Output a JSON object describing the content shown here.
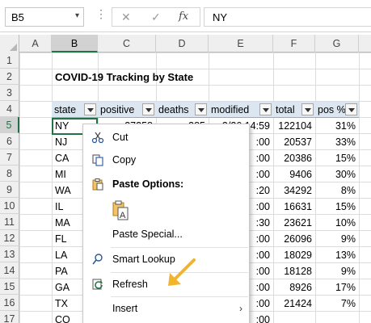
{
  "formula_bar": {
    "name_box": "B5",
    "name_box_arrow": "▾",
    "dots": "⋮",
    "cancel_icon": "✕",
    "enter_icon": "✓",
    "fx_label": "fx",
    "formula": "NY"
  },
  "columns": [
    "A",
    "B",
    "C",
    "D",
    "E",
    "F",
    "G"
  ],
  "rows": [
    "1",
    "2",
    "3",
    "4",
    "5",
    "6",
    "7",
    "8",
    "9",
    "10",
    "11",
    "12",
    "13",
    "14",
    "15",
    "16",
    "17"
  ],
  "title": "COVID-19 Tracking by State",
  "table": {
    "headers": [
      "state",
      "positive",
      "deaths",
      "modified",
      "total",
      "pos %"
    ],
    "rows": [
      {
        "state": "NY",
        "positive": "37258",
        "deaths": "385",
        "modified": "3/26 14:59",
        "total": "122104",
        "pos": "31%"
      },
      {
        "state": "NJ",
        "modified_tail": ":00",
        "total": "20537",
        "pos": "33%"
      },
      {
        "state": "CA",
        "modified_tail": ":00",
        "total": "20386",
        "pos": "15%"
      },
      {
        "state": "MI",
        "modified_tail": ":00",
        "total": "9406",
        "pos": "30%"
      },
      {
        "state": "WA",
        "modified_tail": ":20",
        "total": "34292",
        "pos": "8%"
      },
      {
        "state": "IL",
        "modified_tail": ":00",
        "total": "16631",
        "pos": "15%"
      },
      {
        "state": "MA",
        "modified_tail": ":30",
        "total": "23621",
        "pos": "10%"
      },
      {
        "state": "FL",
        "modified_tail": ":00",
        "total": "26096",
        "pos": "9%"
      },
      {
        "state": "LA",
        "modified_tail": ":00",
        "total": "18029",
        "pos": "13%"
      },
      {
        "state": "PA",
        "modified_tail": ":00",
        "total": "18128",
        "pos": "9%"
      },
      {
        "state": "GA",
        "modified_tail": ":00",
        "total": "8926",
        "pos": "17%"
      },
      {
        "state": "TX",
        "modified_tail": ":00",
        "total": "21424",
        "pos": "7%"
      },
      {
        "state": "CO",
        "modified_tail": ":00",
        "total": "",
        "pos": ""
      }
    ]
  },
  "context_menu": {
    "cut": "Cut",
    "copy": "Copy",
    "paste_options": "Paste Options:",
    "paste_special": "Paste Special...",
    "smart_lookup": "Smart Lookup",
    "refresh": "Refresh",
    "insert": "Insert",
    "submenu_arrow": "›"
  },
  "colors": {
    "excel_green": "#217346",
    "table_header": "#dce6f1",
    "arrow": "#f2b42a"
  }
}
